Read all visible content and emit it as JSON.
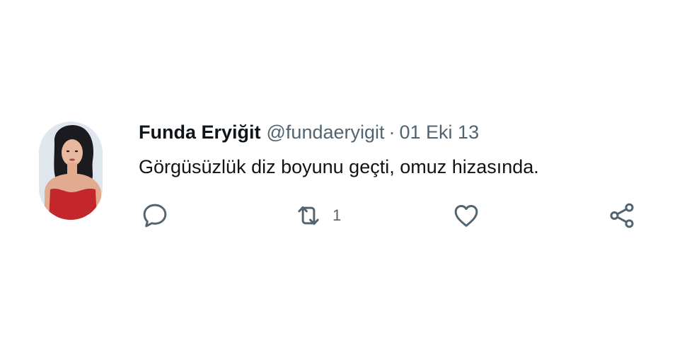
{
  "tweet": {
    "author_name": "Funda Eryiğit",
    "handle": "@fundaeryigit",
    "separator": "·",
    "date": "01 Eki 13",
    "text": "Görgüsüzlük diz boyunu geçti, omuz hizasında.",
    "retweet_count": "1"
  },
  "icons": {
    "reply": "reply-icon",
    "retweet": "retweet-icon",
    "like": "heart-icon",
    "share": "share-icon"
  },
  "colors": {
    "text_primary": "#0f1419",
    "text_secondary": "#536471",
    "background": "#ffffff"
  }
}
